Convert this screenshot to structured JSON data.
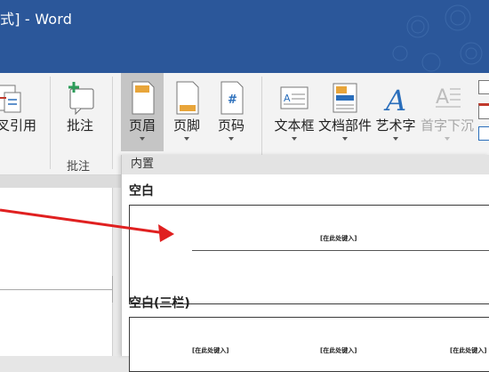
{
  "titlebar": {
    "title": "式] - Word"
  },
  "ribbon": {
    "buttons": {
      "crossref": "叉引用",
      "comment": "批注",
      "header": "页眉",
      "footer": "页脚",
      "pagenum": "页码",
      "textbox": "文本框",
      "docparts": "文档部件",
      "wordart": "艺术字",
      "dropcap": "首字下沉"
    },
    "groups": {
      "comment_group": "批注"
    },
    "colors": {
      "accent": "#2b579a",
      "active_button": "#c5c5c5"
    }
  },
  "dropdown": {
    "header": "内置",
    "sections": [
      {
        "title": "空白",
        "placeholders": [
          "[在此处键入]"
        ]
      },
      {
        "title": "空白(三栏)",
        "placeholders": [
          "[在此处键入]",
          "[在此处键入]",
          "[在此处键入]"
        ]
      }
    ]
  },
  "annotation": {
    "arrow_color": "#e02020"
  }
}
